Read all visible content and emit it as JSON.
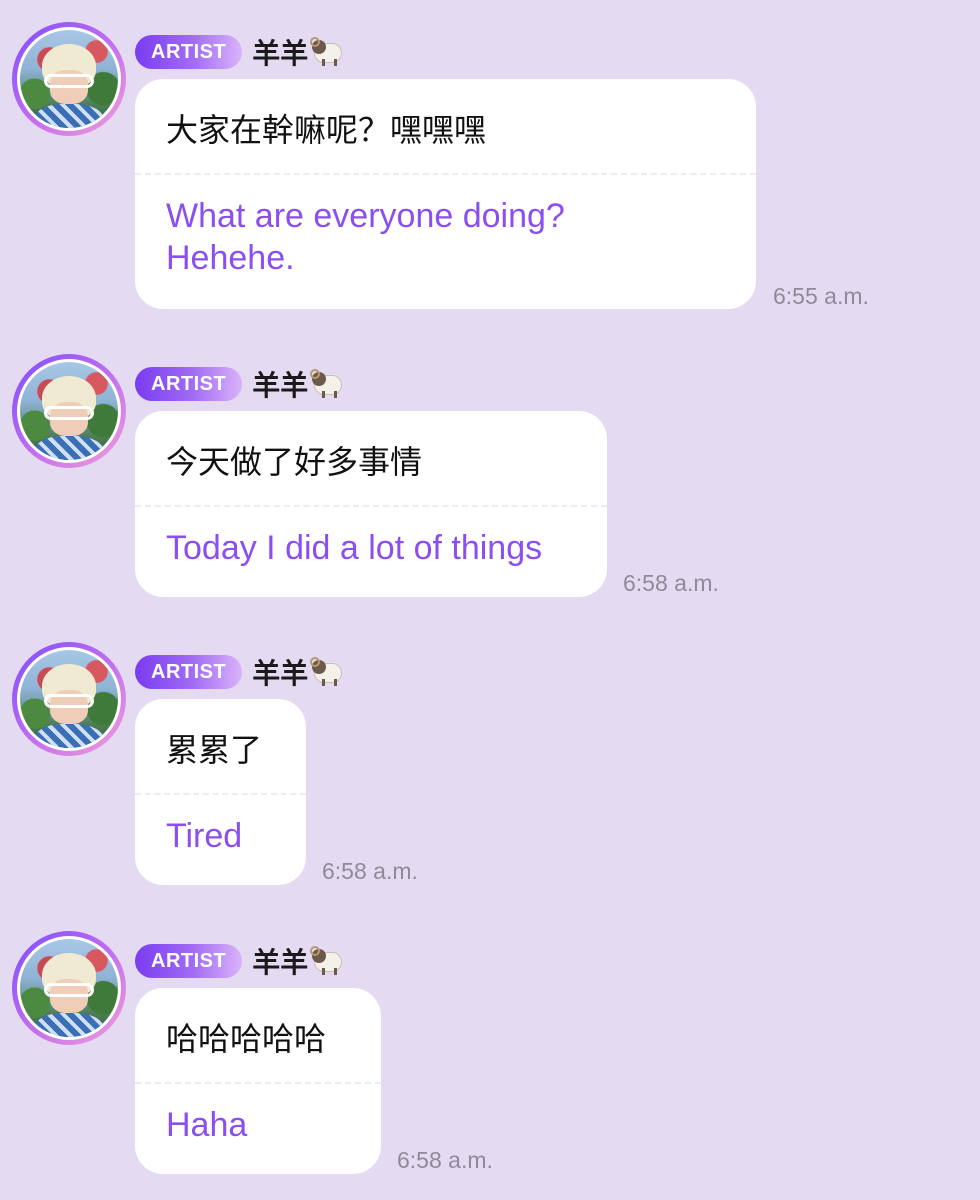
{
  "colors": {
    "background": "#e4daf2",
    "bubble": "#ffffff",
    "translation_text": "#8b4ff0",
    "badge_start": "#7a3cf0",
    "badge_end": "#d9b4f8",
    "timestamp": "#8f8a98"
  },
  "messages": [
    {
      "badge": "ARTIST",
      "sender": "羊羊",
      "sender_emoji": "ram-icon",
      "original": "大家在幹嘛呢？嘿嘿嘿",
      "translation": "What are everyone doing? Hehehe.",
      "time": "6:55 a.m."
    },
    {
      "badge": "ARTIST",
      "sender": "羊羊",
      "sender_emoji": "ram-icon",
      "original": "今天做了好多事情",
      "translation": "Today I did a lot of things",
      "time": "6:58 a.m."
    },
    {
      "badge": "ARTIST",
      "sender": "羊羊",
      "sender_emoji": "ram-icon",
      "original": "累累了",
      "translation": "Tired",
      "time": "6:58 a.m."
    },
    {
      "badge": "ARTIST",
      "sender": "羊羊",
      "sender_emoji": "ram-icon",
      "original": "哈哈哈哈哈",
      "translation": "Haha",
      "time": "6:58 a.m."
    }
  ]
}
